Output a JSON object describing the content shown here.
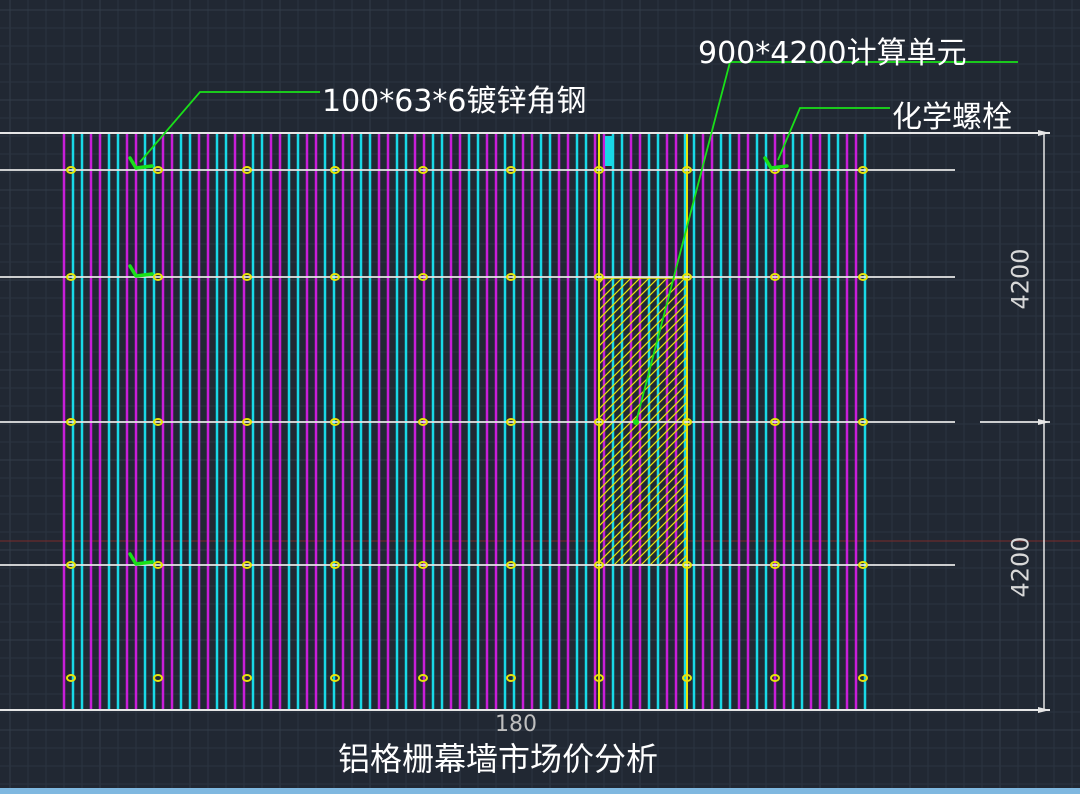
{
  "drawing": {
    "colors": {
      "background": "#212833",
      "grid_minor": "#2b3440",
      "grid_major": "#333d4a",
      "line_white": "#e6e6e6",
      "magenta": "#c81ed8",
      "cyan": "#19d8e6",
      "yellow": "#e8e40a",
      "leader_green": "#19e019",
      "red_axis": "#7a2a2a"
    },
    "labels": {
      "steel_angle": "100*63*6镀锌角钢",
      "calc_unit": "900*4200计算单元",
      "chem_bolt": "化学螺栓",
      "dim_top": "4200",
      "dim_bottom": "4200",
      "bottom_dim": "180",
      "caption": "铝格栅幕墙市场价分析"
    }
  }
}
